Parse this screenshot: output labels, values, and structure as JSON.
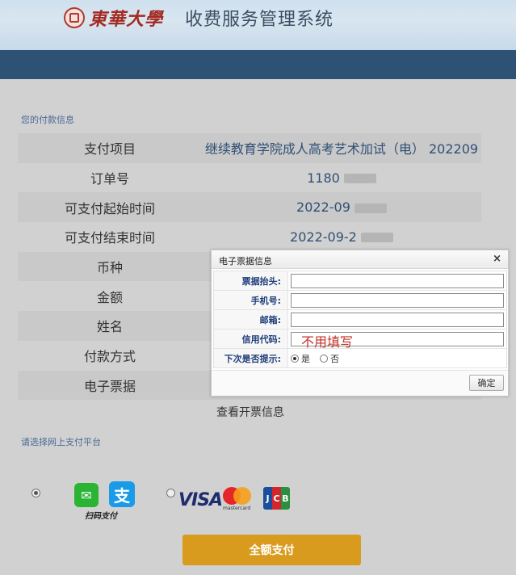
{
  "header": {
    "logo_text": "東華大學",
    "system_title": "收费服务管理系统"
  },
  "payment_info": {
    "section_label": "您的付款信息",
    "rows": [
      {
        "label": "支付项目",
        "value": "继续教育学院成人高考艺术加试（电） 202209"
      },
      {
        "label": "订单号",
        "value": "1180"
      },
      {
        "label": "可支付起始时间",
        "value": "2022-09"
      },
      {
        "label": "可支付结束时间",
        "value": "2022-09-2"
      },
      {
        "label": "币种",
        "value": ""
      },
      {
        "label": "金额",
        "value": ""
      },
      {
        "label": "姓名",
        "value": ""
      },
      {
        "label": "付款方式",
        "value": ""
      },
      {
        "label": "电子票据",
        "value": ""
      }
    ],
    "view_invoice_link": "查看开票信息"
  },
  "platform": {
    "section_label": "请选择网上支付平台",
    "scan_pay_label": "扫码支付",
    "visa_label": "VISA",
    "mastercard_label": "mastercard",
    "jcb_letters": [
      "J",
      "C",
      "B"
    ],
    "wechat_icon": "wechat-icon",
    "alipay_icon": "alipay-icon",
    "alipay_glyph": "支",
    "selected": "scan-pay"
  },
  "pay_button_label": "全额支付",
  "dialog": {
    "title": "电子票据信息",
    "close_glyph": "×",
    "fields": {
      "invoice_title_label": "票据抬头:",
      "invoice_title_value": "",
      "phone_label": "手机号:",
      "phone_value": "",
      "email_label": "邮箱:",
      "email_value": "",
      "credit_code_label": "信用代码:",
      "credit_code_value": "",
      "credit_code_annotation": "不用填写",
      "remind_label": "下次是否提示:",
      "remind_yes": "是",
      "remind_no": "否",
      "remind_selected": "yes"
    },
    "ok_button": "确定"
  },
  "colors": {
    "nav_bar": "#2e5274",
    "pay_button": "#d99b1e",
    "annotation": "#c3312a",
    "label_blue": "#1f3d7a"
  }
}
